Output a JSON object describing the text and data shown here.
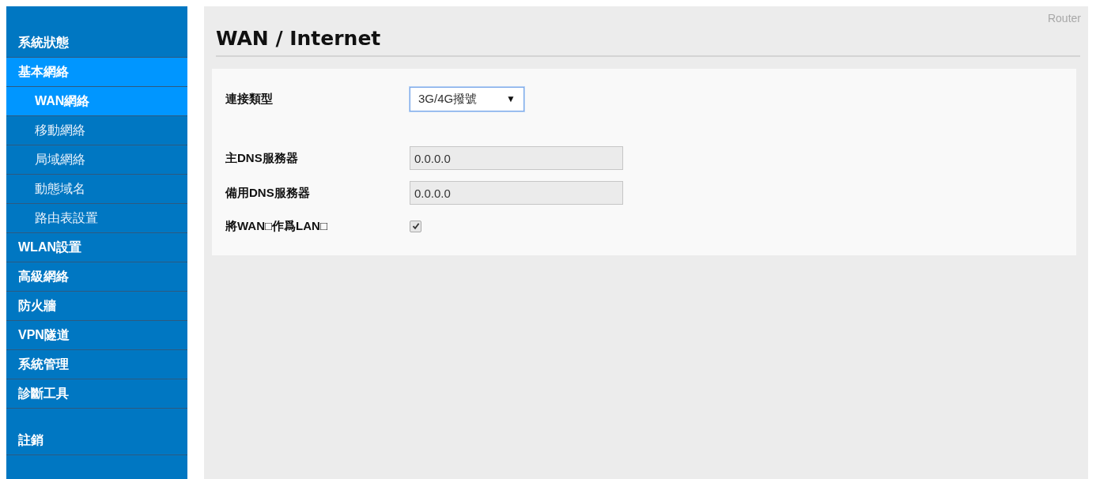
{
  "sidebar": {
    "items": [
      {
        "label": "系統狀態",
        "selected": false
      },
      {
        "label": "基本網絡",
        "selected": true,
        "children": [
          {
            "label": "WAN網絡",
            "selected": true
          },
          {
            "label": "移動網絡",
            "selected": false
          },
          {
            "label": "局域網絡",
            "selected": false
          },
          {
            "label": "動態域名",
            "selected": false
          },
          {
            "label": "路由表設置",
            "selected": false
          }
        ]
      },
      {
        "label": "WLAN設置",
        "selected": false
      },
      {
        "label": "高級網絡",
        "selected": false
      },
      {
        "label": "防火牆",
        "selected": false
      },
      {
        "label": "VPN隧道",
        "selected": false
      },
      {
        "label": "系統管理",
        "selected": false
      },
      {
        "label": "診斷工具",
        "selected": false
      }
    ],
    "logout": "註銷"
  },
  "header": {
    "brand": "Router",
    "title": "WAN / Internet"
  },
  "form": {
    "rows": [
      {
        "kind": "select",
        "label": "連接類型",
        "value": "3G/4G撥號",
        "arrow": "▼"
      },
      {
        "kind": "text",
        "label": "主DNS服務器",
        "value": "0.0.0.0"
      },
      {
        "kind": "text",
        "label": "備用DNS服務器",
        "value": "0.0.0.0"
      },
      {
        "kind": "checkbox",
        "label": "將WAN□作爲LAN□",
        "checked": true
      }
    ]
  }
}
